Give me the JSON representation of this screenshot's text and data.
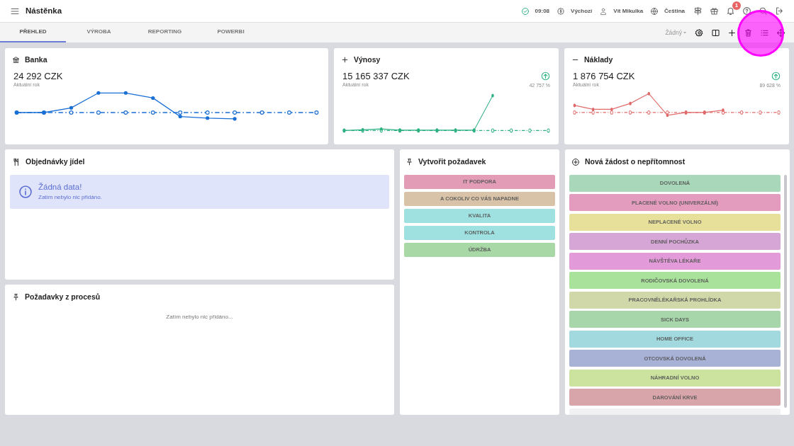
{
  "header": {
    "title": "Nástěnka",
    "time": "09:08",
    "currency": "Výchozí",
    "user": "Vít Mikulka",
    "language": "Čeština",
    "notifications_badge": "1"
  },
  "tabs": [
    {
      "label": "PŘEHLED",
      "selected": true
    },
    {
      "label": "VÝROBA",
      "selected": false
    },
    {
      "label": "REPORTING",
      "selected": false
    },
    {
      "label": "POWERBI",
      "selected": false
    }
  ],
  "toolbar": {
    "filter": "Žádný"
  },
  "stat_cards": [
    {
      "kind": "bank",
      "title": "Banka",
      "value": "24 292 CZK",
      "subtitle": "Aktuální rok",
      "color": "#1a6fd4"
    },
    {
      "kind": "income",
      "title": "Výnosy",
      "value": "15 165 337 CZK",
      "subtitle": "Aktuální rok",
      "change": "42 757 %",
      "color": "#2bb07f"
    },
    {
      "kind": "costs",
      "title": "Náklady",
      "value": "1 876 754 CZK",
      "subtitle": "Aktuální rok",
      "change": "89 628 %",
      "color": "#e06a6a"
    }
  ],
  "meal_orders": {
    "title": "Objednávky jídel",
    "alert_title": "Žádná data!",
    "alert_text": "Zatím nebylo nic přidáno."
  },
  "process_requests": {
    "title": "Požadavky z procesů",
    "empty_text": "Zatím nebylo nic přidáno..."
  },
  "create_request": {
    "title": "Vytvořit požadavek",
    "items": [
      {
        "label": "IT PODPORA",
        "color": "#e29cb6"
      },
      {
        "label": "A COKOLIV CO VÁS NAPADNE",
        "color": "#d9c3a8"
      },
      {
        "label": "KVALITA",
        "color": "#9fe1e0"
      },
      {
        "label": "KONTROLA",
        "color": "#9fe1e0"
      },
      {
        "label": "ÚDRŽBA",
        "color": "#a8d8a6"
      }
    ]
  },
  "absence_request": {
    "title": "Nová žádost o nepřítomnost",
    "items": [
      {
        "label": "DOVOLENÁ",
        "color": "#a8d8b9"
      },
      {
        "label": "PLACENÉ VOLNO (UNIVERZÁLNÍ)",
        "color": "#e39cbe"
      },
      {
        "label": "NEPLACENÉ VOLNO",
        "color": "#e6e09a"
      },
      {
        "label": "DENNÍ POCHŮZKA",
        "color": "#d6a6d6"
      },
      {
        "label": "NÁVŠTĚVA LÉKAŘE",
        "color": "#e39ad9"
      },
      {
        "label": "RODIČOVSKÁ DOVOLENÁ",
        "color": "#a9e29a"
      },
      {
        "label": "PRACOVNĚLÉKAŘSKÁ PROHLÍDKA",
        "color": "#d0d7a8"
      },
      {
        "label": "SICK DAYS",
        "color": "#a8d6ab"
      },
      {
        "label": "HOME OFFICE",
        "color": "#a1d9de"
      },
      {
        "label": "OTCOVSKÁ DOVOLENÁ",
        "color": "#a8b1d6"
      },
      {
        "label": "NÁHRADNÍ VOLNO",
        "color": "#cbe39e"
      },
      {
        "label": "DAROVÁNÍ KRVE",
        "color": "#d8a6aa"
      },
      {
        "color": "#f1f1f4"
      }
    ]
  }
}
